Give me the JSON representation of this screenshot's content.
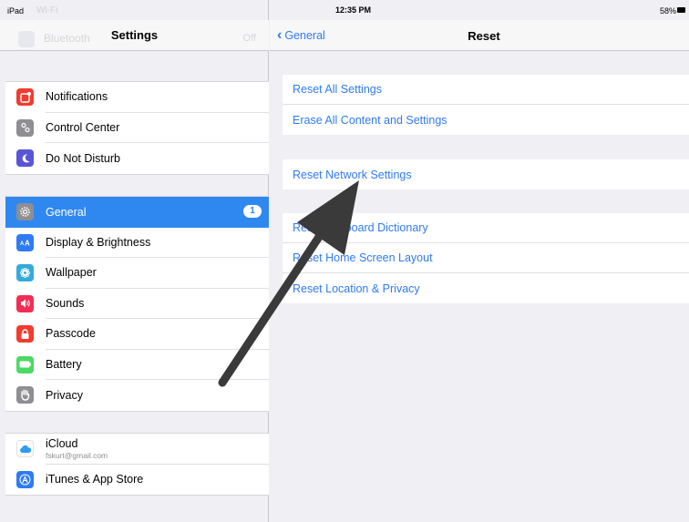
{
  "status_bar": {
    "carrier": "iPad",
    "wifi_label": "Wi-Fi",
    "time": "12:35 PM",
    "battery": "58%"
  },
  "sidebar": {
    "title": "Settings",
    "ghost_row_label": "Bluetooth",
    "ghost_row_value": "Off",
    "groups": [
      [
        {
          "label": "Notifications",
          "icon": "notifications-icon",
          "color": "#f23b30"
        },
        {
          "label": "Control Center",
          "icon": "control-center-icon",
          "color": "#8e8e93"
        },
        {
          "label": "Do Not Disturb",
          "icon": "moon-icon",
          "color": "#5856d6"
        }
      ],
      [
        {
          "label": "General",
          "icon": "gear-icon",
          "color": "#8e8e93",
          "selected": true,
          "badge": "1"
        },
        {
          "label": "Display & Brightness",
          "icon": "display-icon",
          "color": "#2f7bf5"
        },
        {
          "label": "Wallpaper",
          "icon": "wallpaper-icon",
          "color": "#35aadc"
        },
        {
          "label": "Sounds",
          "icon": "speaker-icon",
          "color": "#f22d55"
        },
        {
          "label": "Passcode",
          "icon": "lock-icon",
          "color": "#f23b30"
        },
        {
          "label": "Battery",
          "icon": "battery-icon",
          "color": "#4cd964"
        },
        {
          "label": "Privacy",
          "icon": "hand-icon",
          "color": "#8e8e93"
        }
      ],
      [
        {
          "label": "iCloud",
          "sublabel": "fskurt@gmail.com",
          "icon": "cloud-icon",
          "color": "#ffffff"
        },
        {
          "label": "iTunes & App Store",
          "icon": "app-store-icon",
          "color": "#2f7bf5"
        }
      ]
    ]
  },
  "detail": {
    "back_label": "General",
    "title": "Reset",
    "groups": [
      [
        "Reset All Settings",
        "Erase All Content and Settings"
      ],
      [
        "Reset Network Settings"
      ],
      [
        "Reset Keyboard Dictionary",
        "Reset Home Screen Layout",
        "Reset Location & Privacy"
      ]
    ]
  },
  "colors": {
    "accent": "#2f7bf5",
    "selection": "#2f88f0",
    "arrow": "#3a3a3a"
  }
}
